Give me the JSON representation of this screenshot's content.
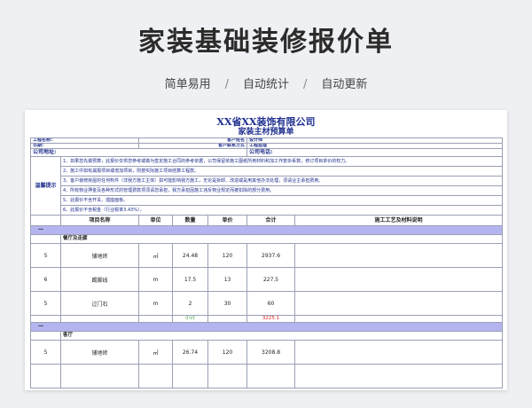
{
  "hero": {
    "title": "家装基础装修报价单",
    "features": [
      "简单易用",
      "自动统计",
      "自动更新"
    ],
    "separator": "/"
  },
  "sheet": {
    "company": "XX省XX装饰有限公司",
    "doc_title": "家装主材预算单",
    "info_rows": [
      [
        "工程名称:",
        "客户姓名",
        "设计师"
      ],
      [
        "日期:",
        "客户联系方式",
        "工程监理"
      ]
    ],
    "address_label": "公司地址:",
    "phone_label": "公司电话:",
    "tips_label": "温馨提示",
    "tips": [
      "1、如果您先做预算，此报价仅供您参考或做为签定施工合同的参考依据，公司保留依施工图纸所用材料和加工作复杂系数，修订项目单价的权力。",
      "2、施工中如有漏报项目或增加项目，则按实际施工项目结算工程款。",
      "3、客户装修房屋的任何构件（非我方施工主体）如可能影响我方施工，无论是拆卸、改造或是用其他办法处理，须请业主承担费用。",
      "4、所有物业押金及各种形式的管理费款项须请您承担，我方承担因施工违反物业规定而被扣除的部分费用。",
      "5、此报价不含开关、插座面板。",
      "6、此报价不含税金（行业税率3.43%）。"
    ],
    "columns": [
      "项目名称",
      "单位",
      "数量",
      "单价",
      "合计",
      "施工工艺及材料说明"
    ],
    "sections": [
      {
        "index": "一",
        "subtitle": "餐厅及走廊",
        "rows": [
          {
            "no": "5",
            "name": "铺地砖",
            "unit": "㎡",
            "qty": "24.48",
            "price": "120",
            "total": "2937.6",
            "note": ""
          },
          {
            "no": "6",
            "name": "踢脚线",
            "unit": "m",
            "qty": "17.5",
            "price": "13",
            "total": "227.5",
            "note": ""
          },
          {
            "no": "5",
            "name": "过门石",
            "unit": "m",
            "qty": "2",
            "price": "30",
            "total": "60",
            "note": ""
          }
        ],
        "subtotal_label": "小计",
        "subtotal_value": "3225.1"
      },
      {
        "index": "一",
        "subtitle": "客厅",
        "rows": [
          {
            "no": "5",
            "name": "铺地砖",
            "unit": "㎡",
            "qty": "26.74",
            "price": "120",
            "total": "3208.8",
            "note": ""
          }
        ]
      }
    ]
  }
}
